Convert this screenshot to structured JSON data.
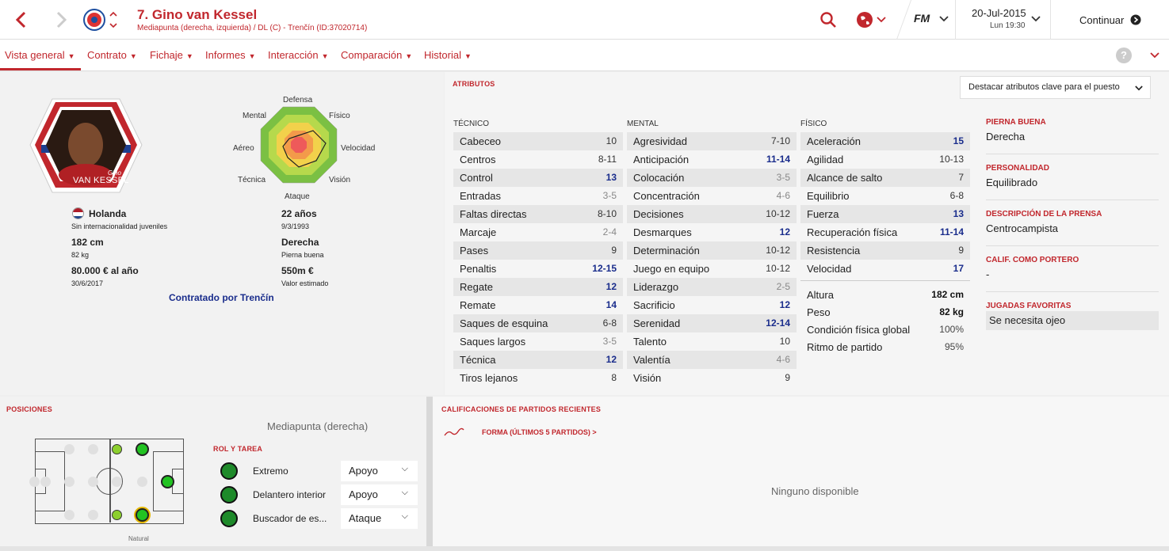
{
  "header": {
    "player_title": "7. Gino van Kessel",
    "player_subtitle": "Mediapunta (derecha, izquierda) / DL (C) - Trenčín (ID:37020714)",
    "date": "20-Jul-2015",
    "day_time": "Lun 19:30",
    "fm_label": "FM",
    "continue_label": "Continuar"
  },
  "nav": {
    "tabs": [
      {
        "label": "Vista general"
      },
      {
        "label": "Contrato"
      },
      {
        "label": "Fichaje"
      },
      {
        "label": "Informes"
      },
      {
        "label": "Interacción"
      },
      {
        "label": "Comparación"
      },
      {
        "label": "Historial"
      }
    ]
  },
  "profile": {
    "card_first": "Gino",
    "card_last": "VAN KESSEL",
    "nationality": "Holanda",
    "intl": "Sin internacionalidad juveniles",
    "height": "182 cm",
    "weight": "82 kg",
    "wage": "80.000 € al año",
    "contract_end": "30/6/2017",
    "age": "22 años",
    "dob": "9/3/1993",
    "foot": "Derecha",
    "foot_label": "Pierna buena",
    "value": "550m €",
    "value_label": "Valor estimado",
    "contracted_by": "Contratado por Trenčín"
  },
  "radar": {
    "labels": [
      "Defensa",
      "Físico",
      "Velocidad",
      "Visión",
      "Ataque",
      "Técnica",
      "Aéreo",
      "Mental"
    ]
  },
  "attributes": {
    "title": "ATRIBUTOS",
    "highlight_dropdown": "Destacar atributos clave para el puesto",
    "technical": {
      "heading": "TÉCNICO",
      "rows": [
        {
          "name": "Cabeceo",
          "value": "10",
          "tier": "mid"
        },
        {
          "name": "Centros",
          "value": "8-11",
          "tier": "mid"
        },
        {
          "name": "Control",
          "value": "13",
          "tier": "hi"
        },
        {
          "name": "Entradas",
          "value": "3-5",
          "tier": "lo"
        },
        {
          "name": "Faltas directas",
          "value": "8-10",
          "tier": "mid"
        },
        {
          "name": "Marcaje",
          "value": "2-4",
          "tier": "lo"
        },
        {
          "name": "Pases",
          "value": "9",
          "tier": "mid"
        },
        {
          "name": "Penaltis",
          "value": "12-15",
          "tier": "hi"
        },
        {
          "name": "Regate",
          "value": "12",
          "tier": "hi"
        },
        {
          "name": "Remate",
          "value": "14",
          "tier": "hi"
        },
        {
          "name": "Saques de esquina",
          "value": "6-8",
          "tier": "mid"
        },
        {
          "name": "Saques largos",
          "value": "3-5",
          "tier": "lo"
        },
        {
          "name": "Técnica",
          "value": "12",
          "tier": "hi"
        },
        {
          "name": "Tiros lejanos",
          "value": "8",
          "tier": "mid"
        }
      ]
    },
    "mental": {
      "heading": "MENTAL",
      "rows": [
        {
          "name": "Agresividad",
          "value": "7-10",
          "tier": "mid"
        },
        {
          "name": "Anticipación",
          "value": "11-14",
          "tier": "hi"
        },
        {
          "name": "Colocación",
          "value": "3-5",
          "tier": "lo"
        },
        {
          "name": "Concentración",
          "value": "4-6",
          "tier": "lo"
        },
        {
          "name": "Decisiones",
          "value": "10-12",
          "tier": "mid"
        },
        {
          "name": "Desmarques",
          "value": "12",
          "tier": "hi"
        },
        {
          "name": "Determinación",
          "value": "10-12",
          "tier": "mid"
        },
        {
          "name": "Juego en equipo",
          "value": "10-12",
          "tier": "mid"
        },
        {
          "name": "Liderazgo",
          "value": "2-5",
          "tier": "lo"
        },
        {
          "name": "Sacrificio",
          "value": "12",
          "tier": "hi"
        },
        {
          "name": "Serenidad",
          "value": "12-14",
          "tier": "hi"
        },
        {
          "name": "Talento",
          "value": "10",
          "tier": "mid"
        },
        {
          "name": "Valentía",
          "value": "4-6",
          "tier": "lo"
        },
        {
          "name": "Visión",
          "value": "9",
          "tier": "mid"
        }
      ]
    },
    "physical": {
      "heading": "FÍSICO",
      "rows": [
        {
          "name": "Aceleración",
          "value": "15",
          "tier": "hi"
        },
        {
          "name": "Agilidad",
          "value": "10-13",
          "tier": "mid"
        },
        {
          "name": "Alcance de salto",
          "value": "7",
          "tier": "mid"
        },
        {
          "name": "Equilibrio",
          "value": "6-8",
          "tier": "mid"
        },
        {
          "name": "Fuerza",
          "value": "13",
          "tier": "hi"
        },
        {
          "name": "Recuperación física",
          "value": "11-14",
          "tier": "hi"
        },
        {
          "name": "Resistencia",
          "value": "9",
          "tier": "mid"
        },
        {
          "name": "Velocidad",
          "value": "17",
          "tier": "hi"
        }
      ]
    },
    "stats": [
      {
        "name": "Altura",
        "value": "182 cm"
      },
      {
        "name": "Peso",
        "value": "82 kg"
      },
      {
        "name": "Condición física global",
        "value": "100%"
      },
      {
        "name": "Ritmo de partido",
        "value": "95%"
      }
    ]
  },
  "side": {
    "items": [
      {
        "label": "PIERNA BUENA",
        "value": "Derecha"
      },
      {
        "label": "PERSONALIDAD",
        "value": "Equilibrado"
      },
      {
        "label": "DESCRIPCIÓN DE LA PRENSA",
        "value": "Centrocampista"
      },
      {
        "label": "CALIF. COMO PORTERO",
        "value": "-"
      },
      {
        "label": "JUGADAS FAVORITAS",
        "value": "Se necesita ojeo"
      }
    ]
  },
  "positions": {
    "title": "POSICIONES",
    "current": "Mediapunta (derecha)",
    "role_title": "ROL Y TAREA",
    "natural_label": "Natural",
    "roles": [
      {
        "role": "Extremo",
        "duty": "Apoyo"
      },
      {
        "role": "Delantero interior",
        "duty": "Apoyo"
      },
      {
        "role": "Buscador de es...",
        "duty": "Ataque"
      }
    ]
  },
  "ratings": {
    "title": "CALIFICACIONES DE PARTIDOS RECIENTES",
    "form_link": "FORMA (ÚLTIMOS 5 PARTIDOS) >",
    "empty": "Ninguno disponible"
  },
  "colors": {
    "accent": "#c1272d",
    "high": "#1a2d8c"
  }
}
